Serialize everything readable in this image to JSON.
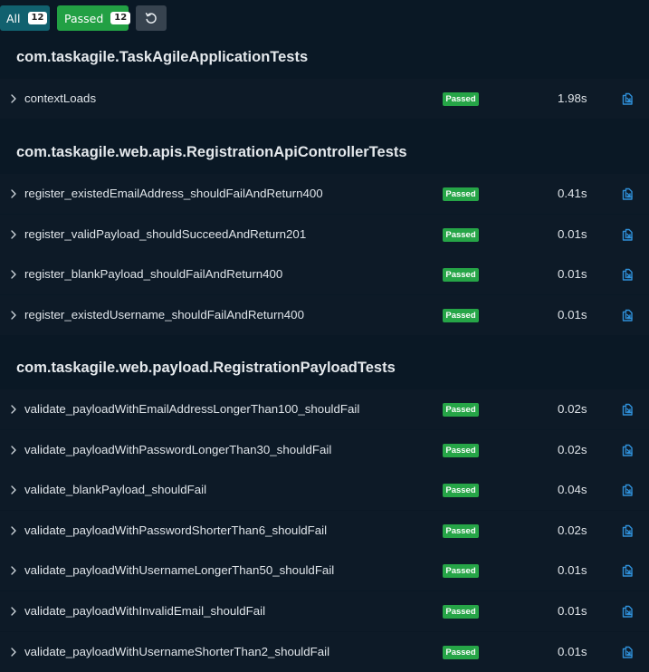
{
  "toolbar": {
    "all_label": "All",
    "all_count": "12",
    "passed_label": "Passed",
    "passed_count": "12",
    "refresh_icon": "refresh-icon"
  },
  "groups": [
    {
      "title": "com.taskagile.TaskAgileApplicationTests",
      "tests": [
        {
          "name": "contextLoads",
          "status": "Passed",
          "duration": "1.98s"
        }
      ]
    },
    {
      "title": "com.taskagile.web.apis.RegistrationApiControllerTests",
      "tests": [
        {
          "name": "register_existedEmailAddress_shouldFailAndReturn400",
          "status": "Passed",
          "duration": "0.41s"
        },
        {
          "name": "register_validPayload_shouldSucceedAndReturn201",
          "status": "Passed",
          "duration": "0.01s"
        },
        {
          "name": "register_blankPayload_shouldFailAndReturn400",
          "status": "Passed",
          "duration": "0.01s"
        },
        {
          "name": "register_existedUsername_shouldFailAndReturn400",
          "status": "Passed",
          "duration": "0.01s"
        }
      ]
    },
    {
      "title": "com.taskagile.web.payload.RegistrationPayloadTests",
      "tests": [
        {
          "name": "validate_payloadWithEmailAddressLongerThan100_shouldFail",
          "status": "Passed",
          "duration": "0.02s"
        },
        {
          "name": "validate_payloadWithPasswordLongerThan30_shouldFail",
          "status": "Passed",
          "duration": "0.02s"
        },
        {
          "name": "validate_blankPayload_shouldFail",
          "status": "Passed",
          "duration": "0.04s"
        },
        {
          "name": "validate_payloadWithPasswordShorterThan6_shouldFail",
          "status": "Passed",
          "duration": "0.02s"
        },
        {
          "name": "validate_payloadWithUsernameLongerThan50_shouldFail",
          "status": "Passed",
          "duration": "0.01s"
        },
        {
          "name": "validate_payloadWithInvalidEmail_shouldFail",
          "status": "Passed",
          "duration": "0.01s"
        },
        {
          "name": "validate_payloadWithUsernameShorterThan2_shouldFail",
          "status": "Passed",
          "duration": "0.01s"
        }
      ]
    }
  ],
  "colors": {
    "background": "#0a1825",
    "row": "#0d1a27",
    "passed": "#26a547",
    "all_button": "#11616f",
    "link_icon": "#2f8fd8"
  }
}
